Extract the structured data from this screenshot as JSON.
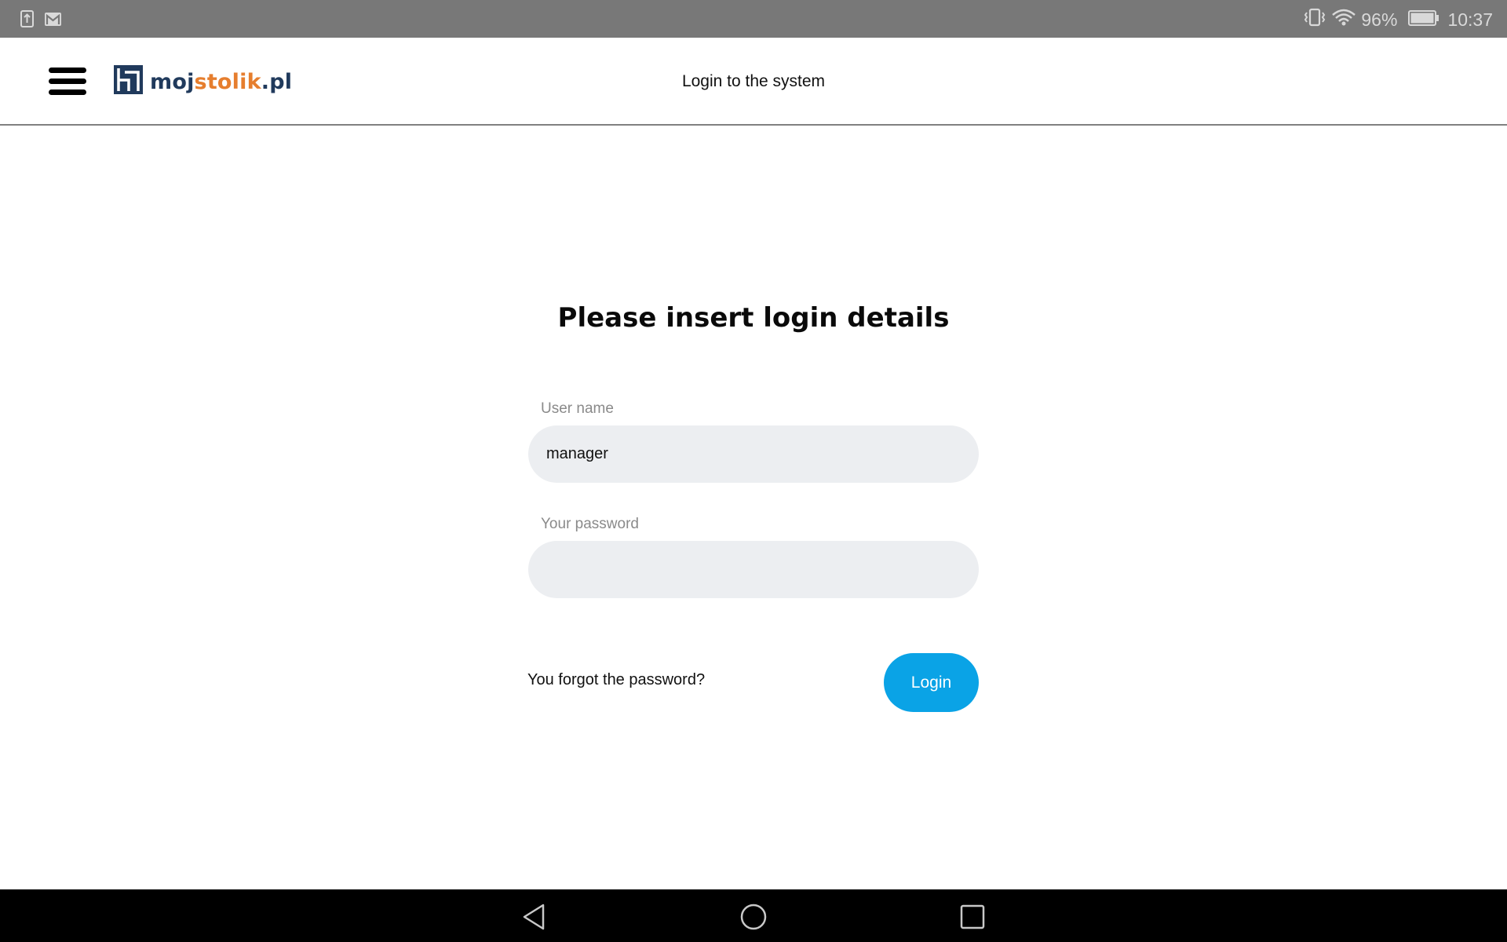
{
  "status_bar": {
    "left_icons": [
      "upload-notification-icon",
      "gmail-icon"
    ],
    "right_icons": [
      "vibrate-icon",
      "wifi-icon",
      "battery-icon"
    ],
    "battery_percent": "96%",
    "time": "10:37"
  },
  "header": {
    "menu_icon": "hamburger-menu-icon",
    "logo": {
      "part1": "moj",
      "part2": "stolik",
      "part3": ".pl",
      "color_primary": "#203a5c",
      "color_accent": "#e67e2e"
    },
    "title": "Login to the system"
  },
  "main": {
    "title": "Please insert login details",
    "username": {
      "label": "User name",
      "value": "manager"
    },
    "password": {
      "label": "Your password",
      "value": ""
    },
    "forgot_link": "You forgot the password?",
    "login_button": "Login",
    "accent_color": "#0aa3e6"
  },
  "nav_bar": {
    "buttons": [
      "back-icon",
      "home-icon",
      "recents-icon"
    ]
  }
}
